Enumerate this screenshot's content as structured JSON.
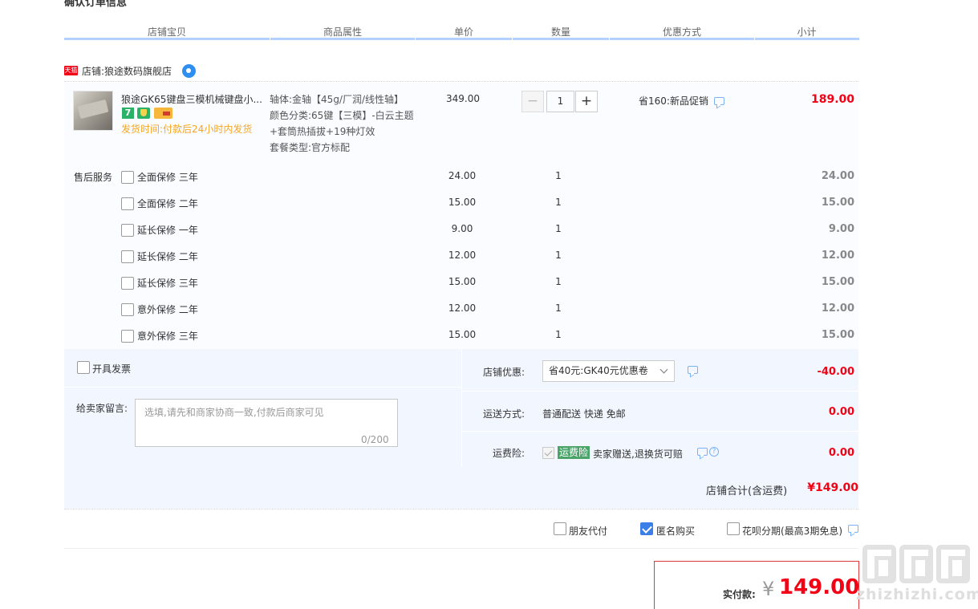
{
  "page": {
    "title": "确认订单信息"
  },
  "columns": [
    "店铺宝贝",
    "商品属性",
    "单价",
    "数量",
    "优惠方式",
    "小计"
  ],
  "shop": {
    "badge": "天猫",
    "label": "店铺:狼途数码旗舰店",
    "chat_icon": "wangwang-icon"
  },
  "item": {
    "title": "狼途GK65键盘三模机械键盘小...",
    "badges": [
      "7",
      "shield-badge-icon",
      "card-badge-icon"
    ],
    "ship_time": "发货时间:付款后24小时内发货",
    "attrs": [
      "轴体:金轴【45g/厂润/线性轴】",
      "颜色分类:65键【三模】-白云主题+套筒热插拔+19种灯效",
      "套餐类型:官方标配"
    ],
    "price": "349.00",
    "qty": "1",
    "qty_minus": "−",
    "qty_plus": "+",
    "promo": "省160:新品促销",
    "subtotal": "189.00"
  },
  "services": {
    "label": "售后服务",
    "rows": [
      {
        "name": "全面保修 三年",
        "price": "24.00",
        "qty": "1",
        "subtotal": "24.00",
        "checked": false
      },
      {
        "name": "全面保修 二年",
        "price": "15.00",
        "qty": "1",
        "subtotal": "15.00",
        "checked": false
      },
      {
        "name": "延长保修 一年",
        "price": "9.00",
        "qty": "1",
        "subtotal": "9.00",
        "checked": false
      },
      {
        "name": "延长保修 二年",
        "price": "12.00",
        "qty": "1",
        "subtotal": "12.00",
        "checked": false
      },
      {
        "name": "延长保修 三年",
        "price": "15.00",
        "qty": "1",
        "subtotal": "15.00",
        "checked": false
      },
      {
        "name": "意外保修 二年",
        "price": "12.00",
        "qty": "1",
        "subtotal": "12.00",
        "checked": false
      },
      {
        "name": "意外保修 三年",
        "price": "15.00",
        "qty": "1",
        "subtotal": "15.00",
        "checked": false
      }
    ]
  },
  "invoice": {
    "label": "开具发票",
    "checked": false
  },
  "message": {
    "label": "给卖家留言:",
    "placeholder": "选填,请先和商家协商一致,付款后商家可见",
    "count": "0/200"
  },
  "shop_discount": {
    "label": "店铺优惠:",
    "selected": "省40元:GK40元优惠卷",
    "amount": "-40.00"
  },
  "shipping": {
    "label": "运送方式:",
    "value": "普通配送 快递 免邮",
    "amount": "0.00"
  },
  "insurance": {
    "label": "运费险:",
    "tag": "运费险",
    "text": "卖家赠送,退换货可赔",
    "help": "?",
    "amount": "0.00"
  },
  "shop_total": {
    "label": "店铺合计(含运费)",
    "amount": "¥149.00"
  },
  "pay_options": [
    {
      "label": "朋友代付",
      "checked": false
    },
    {
      "label": "匿名购买",
      "checked": true
    },
    {
      "label": "花呗分期(最高3期免息)",
      "checked": false
    }
  ],
  "actual": {
    "label": "实付款:",
    "currency": "¥",
    "amount": "149.00"
  },
  "watermark": {
    "text": "zhizhizhi.com"
  },
  "colors": {
    "accent_red": "#f10215",
    "header_line": "#b2d1ff",
    "panel_bg": "#f2f7ff",
    "check_blue": "#3b7ee8"
  }
}
